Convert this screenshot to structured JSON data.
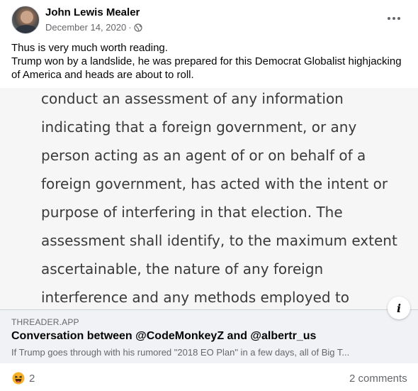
{
  "post": {
    "author": "John Lewis Mealer",
    "date": "December 14, 2020",
    "separator": "·",
    "privacy_icon": "globe-icon",
    "more_icon": "more-horizontal-icon",
    "text_lines": [
      "Thus is very much worth reading.",
      "Trump won by a landslide, he was prepared for this Democrat Globalist highjacking",
      "of America and heads are about to roll."
    ]
  },
  "preview": {
    "document_lines": [
      "conduct an assessment of any information",
      "indicating that a foreign government, or any",
      "person acting as an agent of or on behalf of a",
      "foreign government, has acted with the intent or",
      "purpose of interfering in that election. The",
      "assessment shall identify, to the maximum extent",
      "ascertainable, the nature of any foreign",
      "interference and any methods employed to"
    ]
  },
  "link": {
    "domain": "THREADER.APP",
    "title": "Conversation between @CodeMonkeyZ and @albertr_us",
    "description": "If Trump goes through with his rumored \"2018 EO Plan\" in a few days, all of Big T...",
    "info_label": "i"
  },
  "footer": {
    "reaction_icon": "haha-reaction-icon",
    "reaction_count": "2",
    "comments": "2 comments"
  },
  "colors": {
    "secondary_text": "#65676b",
    "link_bg": "#f0f2f5",
    "reaction_yellow": "#f7b125"
  }
}
